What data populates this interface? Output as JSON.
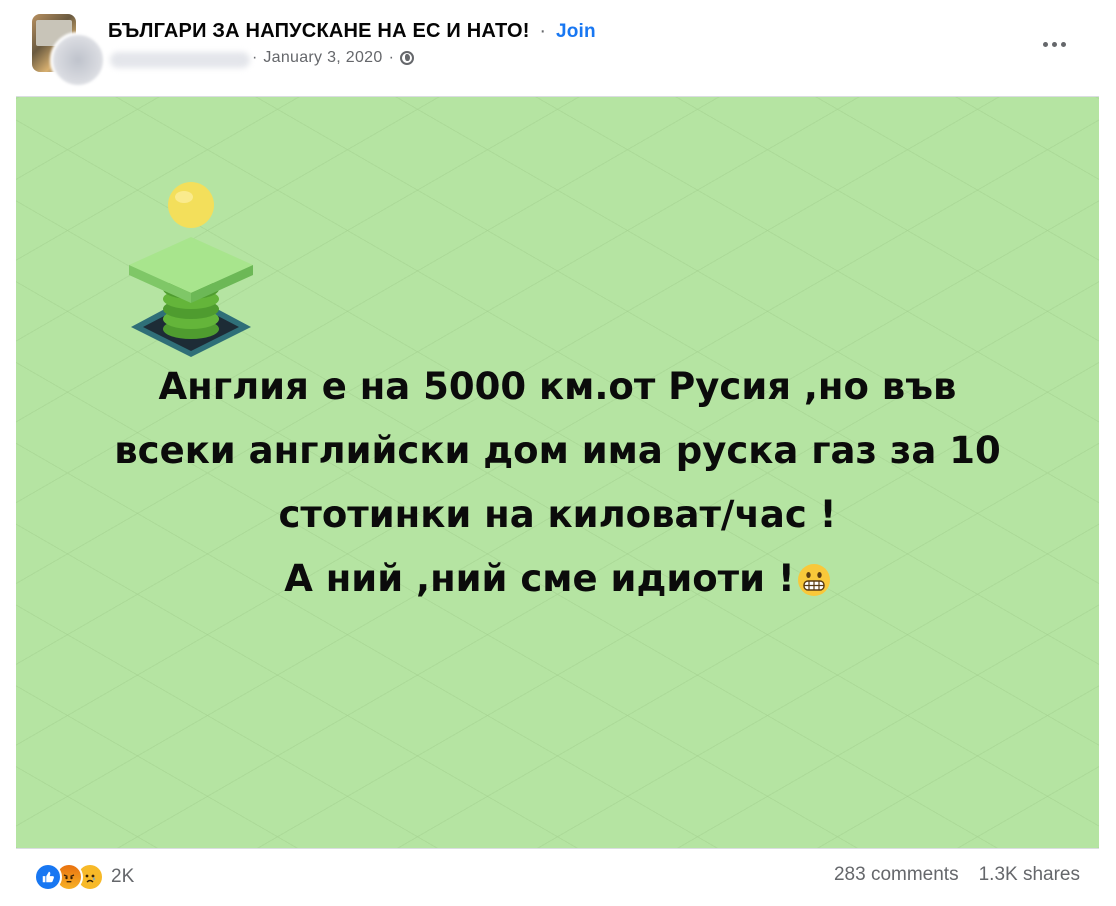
{
  "header": {
    "group_name": "БЪЛГАРИ ЗА НАПУСКАНЕ НА ЕС И НАТО!",
    "separator": "·",
    "join_label": "Join",
    "date": "January 3, 2020",
    "privacy_icon": "globe-icon",
    "more_icon": "more-options-icon"
  },
  "post_image": {
    "background_color": "#b5e4a2",
    "text_lines": [
      "Англия е на 5000 км.от Русия ,но във",
      "всеки английски дом има руска газ за 10",
      "стотинки на киловат/час !",
      "А ний ,ний сме идиоти !"
    ],
    "emoji": "grimacing-face"
  },
  "footer": {
    "reaction_icons": [
      "like-icon",
      "angry-icon",
      "sad-icon"
    ],
    "reaction_count": "2K",
    "comments": "283 comments",
    "shares": "1.3K shares"
  },
  "colors": {
    "link": "#1877f2",
    "secondary_text": "#65676b",
    "primary_text": "#050505"
  }
}
